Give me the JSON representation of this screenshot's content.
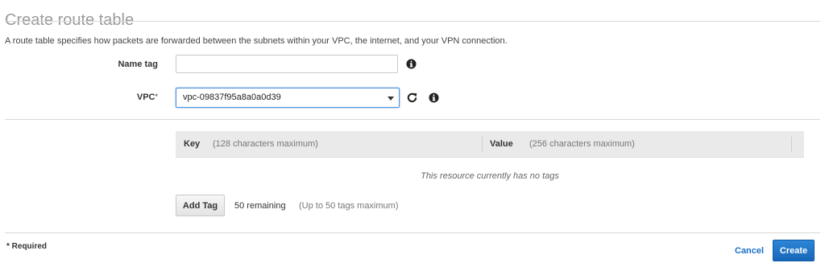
{
  "page": {
    "title": "Create route table",
    "description": "A route table specifies how packets are forwarded between the subnets within your VPC, the internet, and your VPN connection."
  },
  "form": {
    "name_tag": {
      "label": "Name tag",
      "value": "",
      "placeholder": "",
      "info_icon": "info-icon"
    },
    "vpc": {
      "label": "VPC",
      "required_marker": "*",
      "selected_value": "vpc-09837f95a8a0a0d39",
      "refresh_icon": "refresh-icon",
      "info_icon": "info-icon"
    }
  },
  "tags": {
    "columns": [
      {
        "label": "Key",
        "hint": "(128 characters maximum)"
      },
      {
        "label": "Value",
        "hint": "(256 characters maximum)"
      }
    ],
    "empty_message": "This resource currently has no tags",
    "add_button_label": "Add Tag",
    "remaining": "50 remaining",
    "remaining_hint": "(Up to 50 tags maximum)"
  },
  "footer": {
    "required_note": "* Required",
    "cancel_label": "Cancel",
    "create_label": "Create"
  },
  "colors": {
    "primary_button": "#1766b8",
    "link": "#1a6fc9",
    "focus_border": "#4a90d9"
  }
}
